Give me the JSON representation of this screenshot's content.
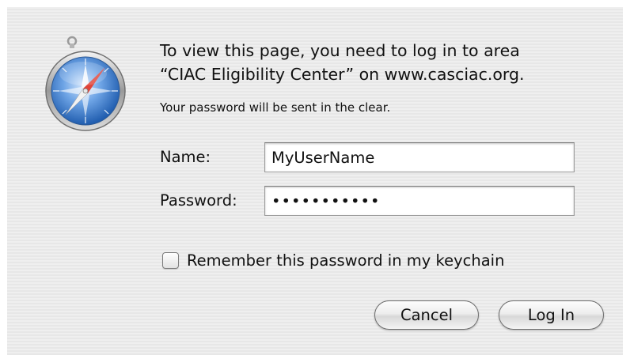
{
  "dialog": {
    "icon": "safari-compass-icon",
    "message_line1": "To view this page, you need to log in to area",
    "message_line2": "“CIAC Eligibility Center” on www.casciac.org.",
    "note": "Your password will be sent in the clear."
  },
  "form": {
    "name_label": "Name:",
    "name_value": "MyUserName",
    "password_label": "Password:",
    "password_value": "•••••••••••",
    "remember_label": "Remember this password in my keychain",
    "remember_checked": false
  },
  "buttons": {
    "cancel_label": "Cancel",
    "login_label": "Log In"
  },
  "colors": {
    "dialog_background": "#ececec",
    "compass_blue": "#3f7fd0",
    "needle_red": "#e0443a"
  }
}
